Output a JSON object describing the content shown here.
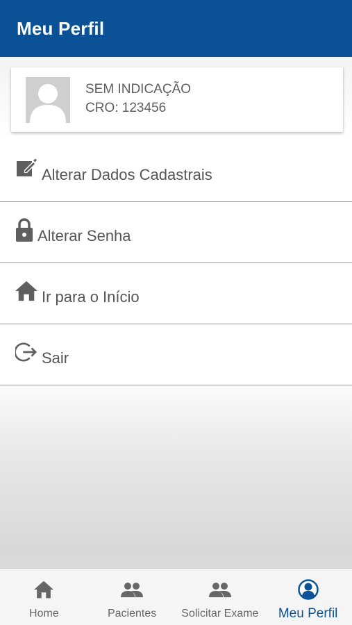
{
  "appbar": {
    "title": "Meu Perfil"
  },
  "profile": {
    "name": "SEM INDICAÇÃO",
    "cro": "CRO: 123456"
  },
  "menu": {
    "items": [
      {
        "label": "Alterar Dados Cadastrais",
        "icon": "edit-icon"
      },
      {
        "label": "Alterar Senha",
        "icon": "lock-icon"
      },
      {
        "label": "Ir para o Início",
        "icon": "home-icon"
      },
      {
        "label": "Sair",
        "icon": "logout-icon"
      }
    ]
  },
  "bottom_nav": {
    "items": [
      {
        "label": "Home",
        "icon": "home-icon"
      },
      {
        "label": "Pacientes",
        "icon": "people-icon"
      },
      {
        "label": "Solicitar Exame",
        "icon": "people-icon"
      },
      {
        "label": "Meu Perfil",
        "icon": "account-circle-icon",
        "active": true
      }
    ]
  },
  "colors": {
    "primary": "#0a5196",
    "icon_gray": "#5f5f5f",
    "text_gray": "#555555"
  }
}
